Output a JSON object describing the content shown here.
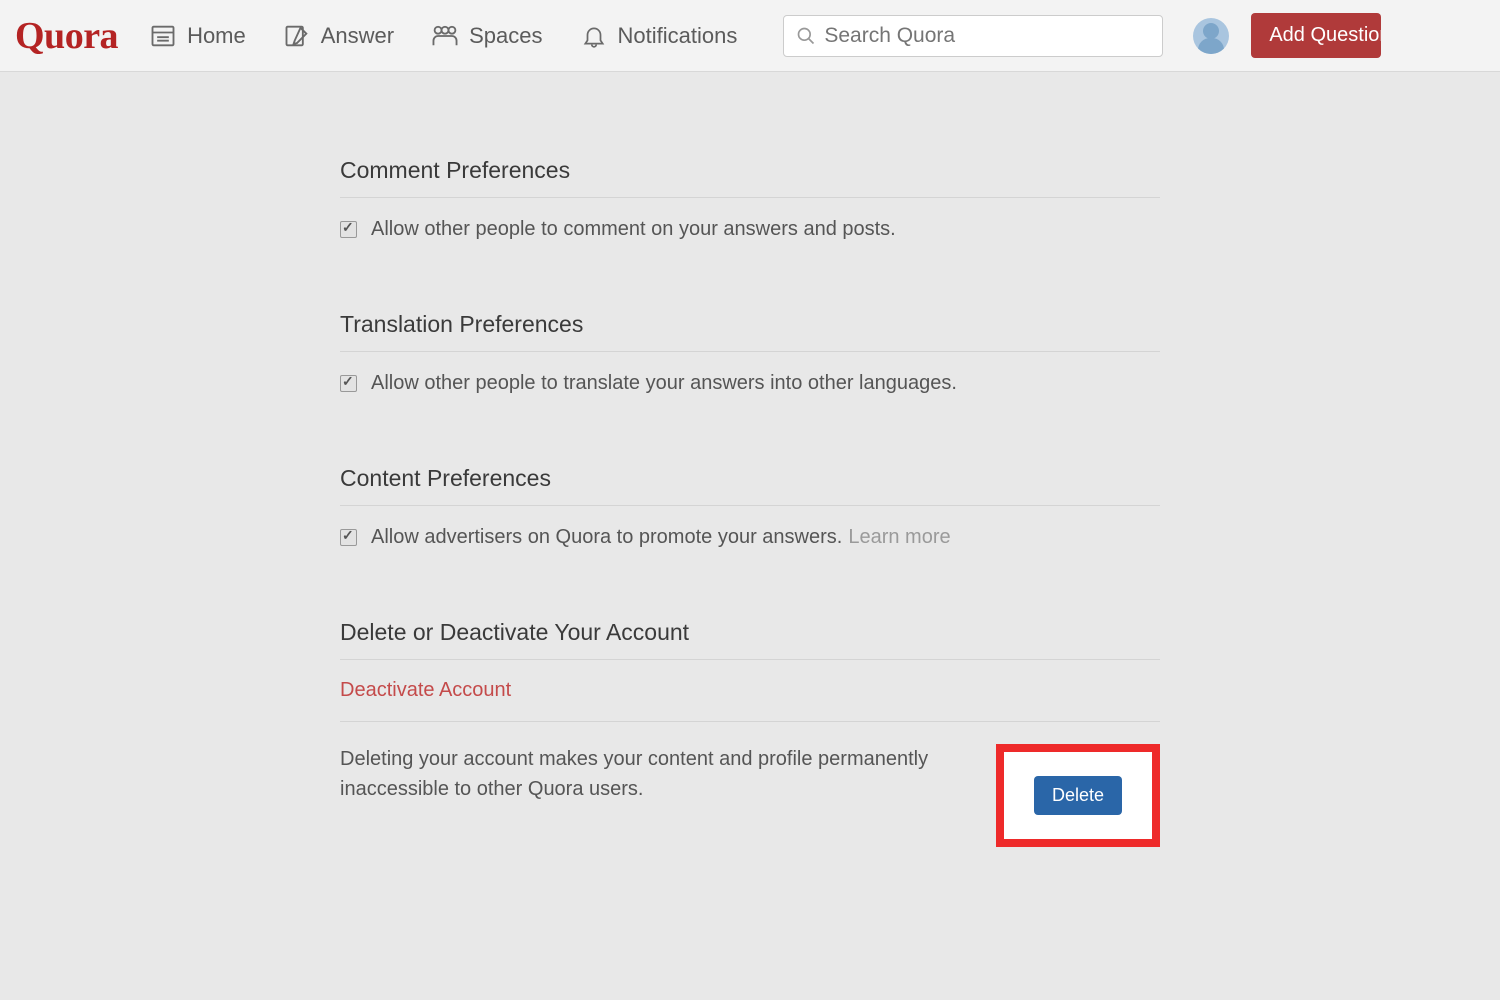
{
  "brand": "Quora",
  "nav": {
    "home": "Home",
    "answer": "Answer",
    "spaces": "Spaces",
    "notifications": "Notifications"
  },
  "search": {
    "placeholder": "Search Quora"
  },
  "add_question": "Add Question",
  "sections": {
    "comment": {
      "title": "Comment Preferences",
      "option": "Allow other people to comment on your answers and posts."
    },
    "translation": {
      "title": "Translation Preferences",
      "option": "Allow other people to translate your answers into other languages."
    },
    "content": {
      "title": "Content Preferences",
      "option": "Allow advertisers on Quora to promote your answers.",
      "learn_more": "Learn more"
    },
    "delete": {
      "title": "Delete or Deactivate Your Account",
      "deactivate_link": "Deactivate Account",
      "delete_text": "Deleting your account makes your content and profile permanently inaccessible to other Quora users.",
      "delete_button": "Delete"
    }
  }
}
